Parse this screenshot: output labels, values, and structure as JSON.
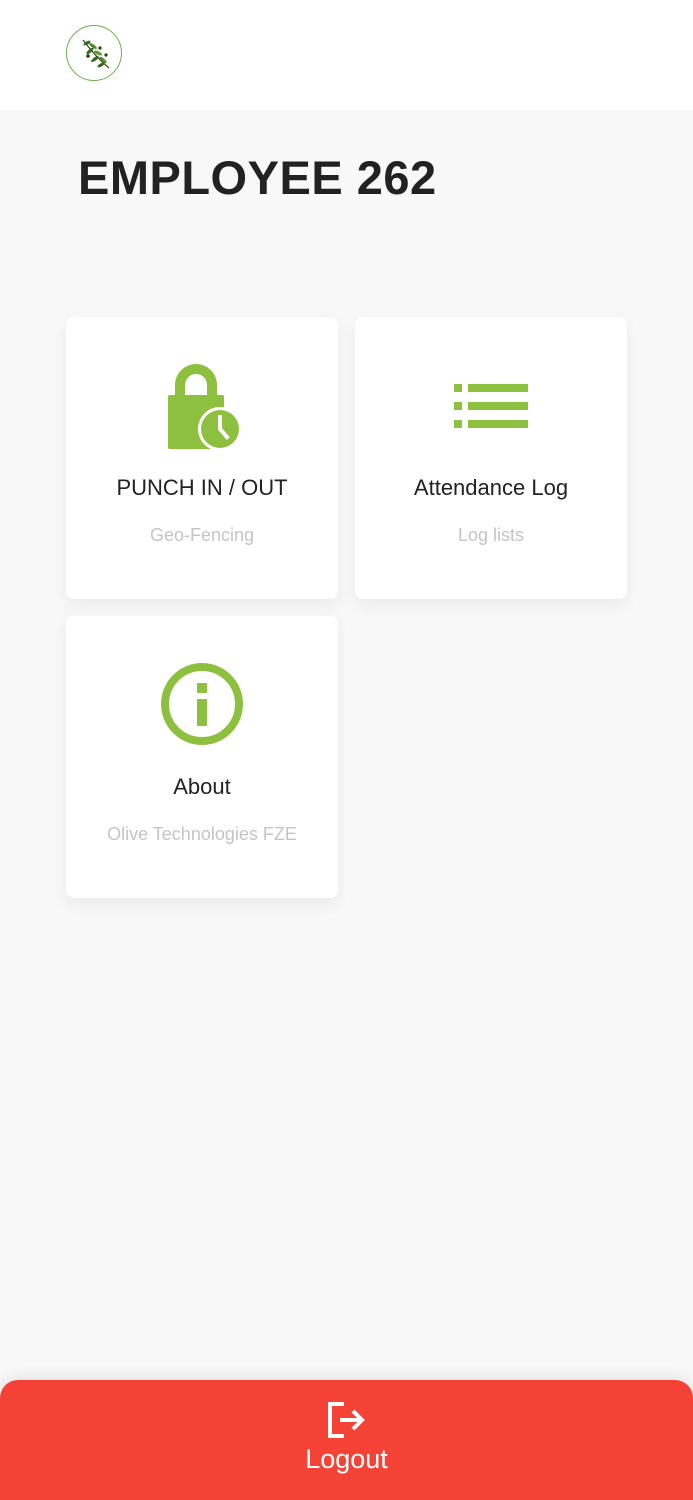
{
  "header": {
    "logo_icon": "olive-branch-logo"
  },
  "page": {
    "title": "EMPLOYEE 262"
  },
  "accent_color": "#8dc03f",
  "cards": [
    {
      "icon": "lock-clock-icon",
      "title": "PUNCH IN / OUT",
      "subtitle": "Geo-Fencing"
    },
    {
      "icon": "list-icon",
      "title": "Attendance Log",
      "subtitle": "Log lists"
    },
    {
      "icon": "info-icon",
      "title": "About",
      "subtitle": "Olive Technologies FZE"
    }
  ],
  "logout": {
    "label": "Logout",
    "icon": "logout-icon",
    "color": "#f44336"
  }
}
